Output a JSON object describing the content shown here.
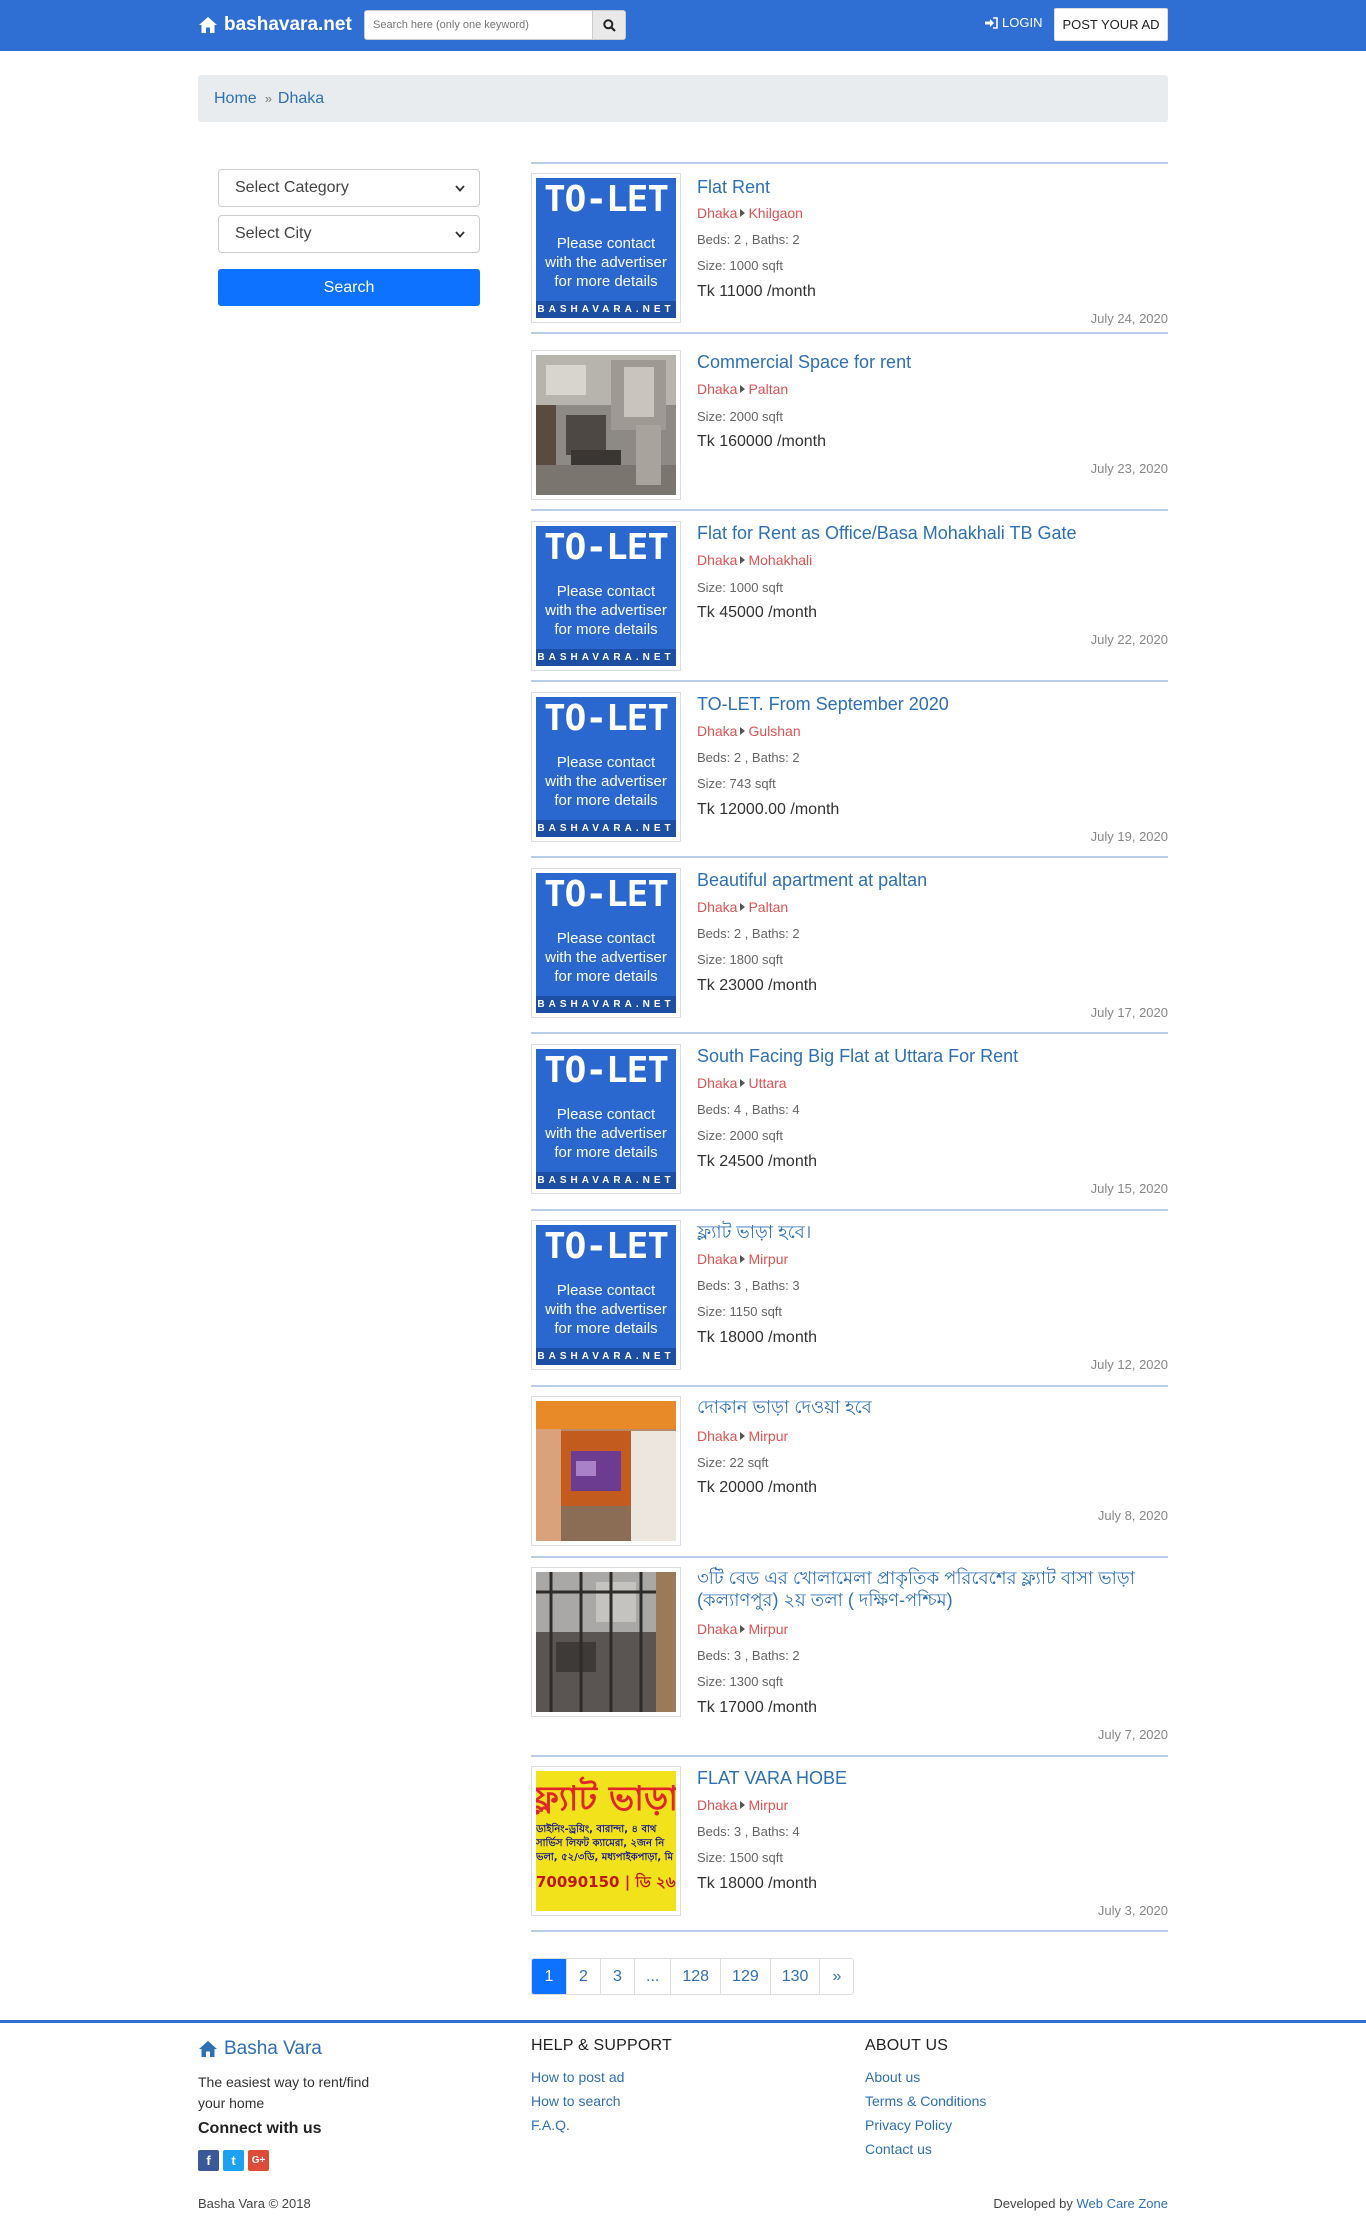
{
  "header": {
    "brand": "bashavara.net",
    "search_placeholder": "Search here (only one keyword)",
    "login_label": "LOGIN",
    "post_ad_label": "POST YOUR AD",
    "bar_color": "#2f6fd4"
  },
  "breadcrumb": {
    "home": "Home",
    "separator": "»",
    "current": "Dhaka"
  },
  "sidebar": {
    "category_value": "Select Category",
    "city_value": "Select City",
    "search_label": "Search"
  },
  "tolet_image": {
    "headline": "TO-LET",
    "line1": "Please contact",
    "line2": "with the advertiser",
    "line3": "for more details",
    "footer": "BASHAVARA.NET"
  },
  "listings": [
    {
      "title": "Flat Rent",
      "city": "Dhaka",
      "area": "Khilgaon",
      "beds": "Beds: 2 , Baths: 2",
      "size": "Size: 1000 sqft",
      "price": "Tk 11000 /month",
      "date": "July 24, 2020",
      "image": "tolet"
    },
    {
      "title": "Commercial Space for rent",
      "city": "Dhaka",
      "area": "Paltan",
      "beds": "",
      "size": "Size: 2000 sqft",
      "price": "Tk 160000 /month",
      "date": "July 23, 2020",
      "image": "office-photo"
    },
    {
      "title": "Flat for Rent as Office/Basa Mohakhali TB Gate",
      "city": "Dhaka",
      "area": "Mohakhali",
      "beds": "",
      "size": "Size: 1000 sqft",
      "price": "Tk 45000 /month",
      "date": "July 22, 2020",
      "image": "tolet"
    },
    {
      "title": "TO-LET. From September 2020",
      "city": "Dhaka",
      "area": "Gulshan",
      "beds": "Beds: 2 , Baths: 2",
      "size": "Size: 743 sqft",
      "price": "Tk 12000.00 /month",
      "date": "July 19, 2020",
      "image": "tolet"
    },
    {
      "title": "Beautiful apartment at paltan",
      "city": "Dhaka",
      "area": "Paltan",
      "beds": "Beds: 2 , Baths: 2",
      "size": "Size: 1800 sqft",
      "price": "Tk 23000 /month",
      "date": "July 17, 2020",
      "image": "tolet"
    },
    {
      "title": "South Facing Big Flat at Uttara For Rent",
      "city": "Dhaka",
      "area": "Uttara",
      "beds": "Beds: 4 , Baths: 4",
      "size": "Size: 2000 sqft",
      "price": "Tk 24500 /month",
      "date": "July 15, 2020",
      "image": "tolet"
    },
    {
      "title": "ফ্ল্যাট ভাড়া হবে।",
      "city": "Dhaka",
      "area": "Mirpur",
      "beds": "Beds: 3 , Baths: 3",
      "size": "Size: 1150 sqft",
      "price": "Tk 18000 /month",
      "date": "July 12, 2020",
      "image": "tolet"
    },
    {
      "title": "দোকান ভাড়া দেওয়া হবে",
      "city": "Dhaka",
      "area": "Mirpur",
      "beds": "",
      "size": "Size: 22 sqft",
      "price": "Tk 20000 /month",
      "date": "July 8, 2020",
      "image": "shop-photo"
    },
    {
      "title": "৩টি বেড এর খোলামেলা প্রাকৃতিক পরিবেশের ফ্ল্যাট বাসা ভাড়া (কল্যাণপুর) ২য় তলা ( দক্ষিণ-পশ্চিম)",
      "city": "Dhaka",
      "area": "Mirpur",
      "beds": "Beds: 3 , Baths: 2",
      "size": "Size: 1300 sqft",
      "price": "Tk 17000 /month",
      "date": "July 7, 2020",
      "image": "window-photo"
    },
    {
      "title": "FLAT VARA HOBE",
      "city": "Dhaka",
      "area": "Mirpur",
      "beds": "Beds: 3 , Baths: 4",
      "size": "Size: 1500 sqft",
      "price": "Tk 18000 /month",
      "date": "July 3, 2020",
      "image": "sign-photo"
    }
  ],
  "sign_photo": {
    "big": "ফ্ল্যাট ভাড়া হবে",
    "line1": "ডাইনিং-ড্রয়িং, বারান্দা, ৪ বাথ",
    "line2": "সার্ভিস লিফট ক্যামেরা, ২জন নি",
    "line3": "ভলা, ৫২/৩ডি, মধ্যপাইকপাড়া, মি",
    "phone": "70090150 | ডি ২৬"
  },
  "pagination": [
    "1",
    "2",
    "3",
    "...",
    "128",
    "129",
    "130",
    "»"
  ],
  "footer": {
    "brand": "Basha Vara",
    "tagline": "The easiest way to rent/find your home",
    "connect": "Connect with us",
    "social": [
      {
        "name": "facebook",
        "glyph": "f",
        "color": "#3b5998"
      },
      {
        "name": "twitter",
        "glyph": "t",
        "color": "#1da1f2"
      },
      {
        "name": "google-plus",
        "glyph": "G+",
        "color": "#dd4b39"
      }
    ],
    "help_heading": "HELP & SUPPORT",
    "help_links": [
      "How to post ad",
      "How to search",
      "F.A.Q."
    ],
    "about_heading": "ABOUT US",
    "about_links": [
      "About us",
      "Terms & Conditions",
      "Privacy Policy",
      "Contact us"
    ],
    "copyright": "Basha Vara © 2018",
    "developed_by": "Developed by",
    "developer": "Web Care Zone"
  }
}
